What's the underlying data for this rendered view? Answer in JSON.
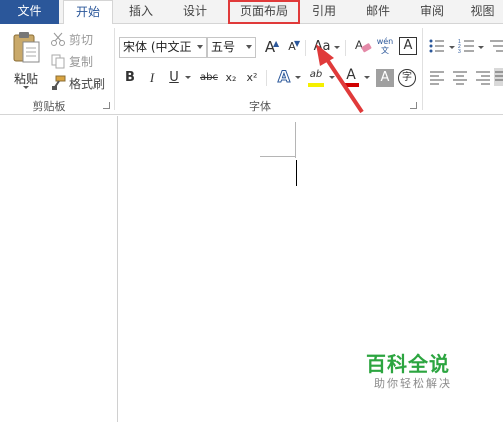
{
  "tabs": [
    {
      "label": "文件"
    },
    {
      "label": "开始"
    },
    {
      "label": "插入"
    },
    {
      "label": "设计"
    },
    {
      "label": "页面布局"
    },
    {
      "label": "引用"
    },
    {
      "label": "邮件"
    },
    {
      "label": "审阅"
    },
    {
      "label": "视图"
    }
  ],
  "clipboard": {
    "group_label": "剪贴板",
    "paste_label": "粘贴",
    "cut_label": "剪切",
    "copy_label": "复制",
    "format_painter_label": "格式刷"
  },
  "font": {
    "group_label": "字体",
    "font_name": "宋体 (中文正",
    "font_size": "五号",
    "grow_glyph": "A",
    "shrink_glyph": "A",
    "case_glyph": "Aa",
    "phonetic_glyph": "wén\n文",
    "border_glyph": "A",
    "bold_glyph": "B",
    "italic_glyph": "I",
    "underline_glyph": "U",
    "strike_glyph": "abc",
    "subscript_glyph": "x₂",
    "superscript_glyph": "x²",
    "effects_glyph": "A",
    "highlight_glyph": "ab",
    "color_glyph": "A",
    "shade_glyph": "A",
    "enclose_glyph": "字"
  },
  "watermark": {
    "title": "百科全说",
    "subtitle": "助你轻松解决"
  },
  "colors": {
    "file_tab": "#2b579a",
    "highlight_box": "#e03a3a",
    "arrow": "#e03a3a",
    "watermark": "#2ca540"
  }
}
